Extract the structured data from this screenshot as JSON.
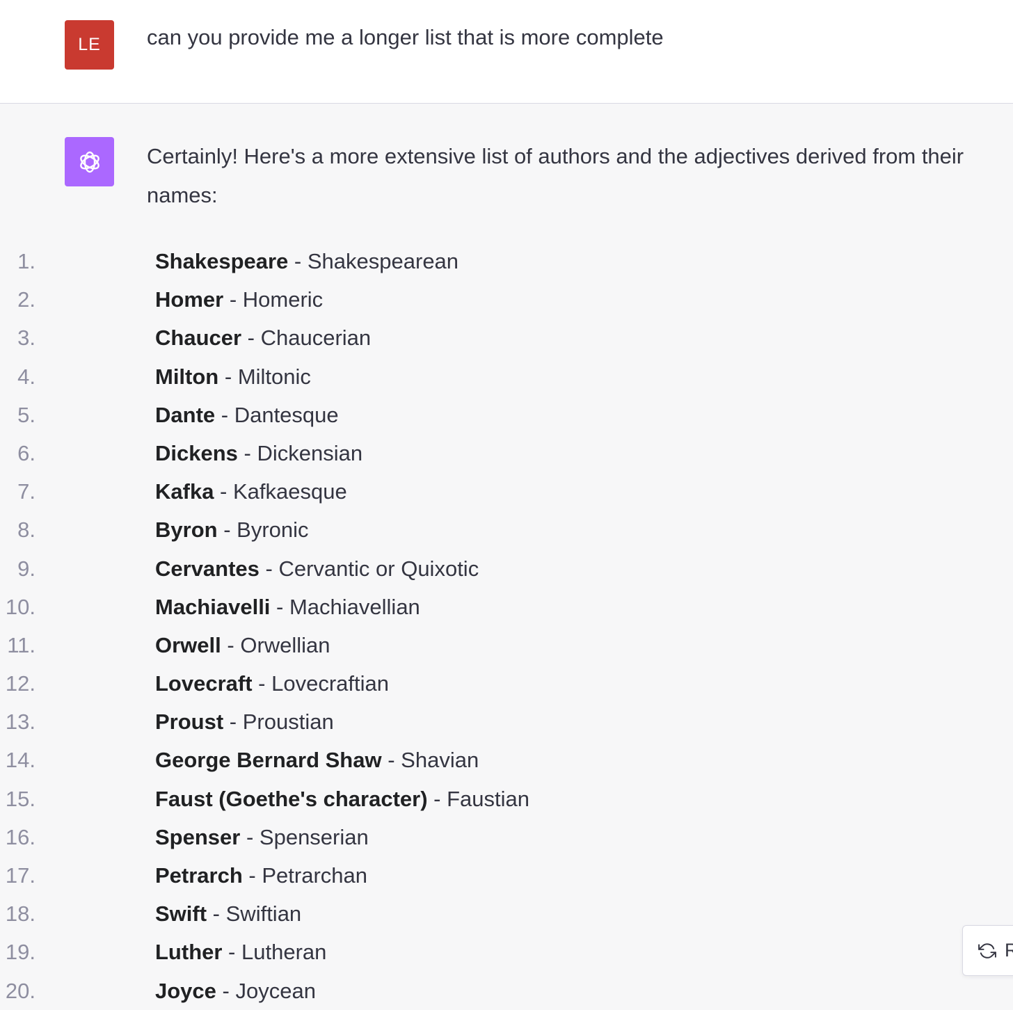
{
  "user_message": {
    "avatar_initials": "LE",
    "text": "can you provide me a longer list that is more complete"
  },
  "assistant_message": {
    "avatar_icon": "openai-logo-icon",
    "intro": "Certainly! Here's a more extensive list of authors and the adjectives derived from their names:",
    "items": [
      {
        "number": "1.",
        "author": "Shakespeare",
        "separator": " - ",
        "adjective": "Shakespearean"
      },
      {
        "number": "2.",
        "author": "Homer",
        "separator": " - ",
        "adjective": "Homeric"
      },
      {
        "number": "3.",
        "author": "Chaucer",
        "separator": " - ",
        "adjective": "Chaucerian"
      },
      {
        "number": "4.",
        "author": "Milton",
        "separator": " - ",
        "adjective": "Miltonic"
      },
      {
        "number": "5.",
        "author": "Dante",
        "separator": " - ",
        "adjective": "Dantesque"
      },
      {
        "number": "6.",
        "author": "Dickens",
        "separator": " - ",
        "adjective": "Dickensian"
      },
      {
        "number": "7.",
        "author": "Kafka",
        "separator": " - ",
        "adjective": "Kafkaesque"
      },
      {
        "number": "8.",
        "author": "Byron",
        "separator": " - ",
        "adjective": "Byronic"
      },
      {
        "number": "9.",
        "author": "Cervantes",
        "separator": " - ",
        "adjective": "Cervantic or Quixotic"
      },
      {
        "number": "10.",
        "author": "Machiavelli",
        "separator": " - ",
        "adjective": "Machiavellian"
      },
      {
        "number": "11.",
        "author": "Orwell",
        "separator": " - ",
        "adjective": "Orwellian"
      },
      {
        "number": "12.",
        "author": "Lovecraft",
        "separator": " - ",
        "adjective": "Lovecraftian"
      },
      {
        "number": "13.",
        "author": "Proust",
        "separator": " - ",
        "adjective": "Proustian"
      },
      {
        "number": "14.",
        "author": "George Bernard Shaw",
        "separator": " - ",
        "adjective": "Shavian"
      },
      {
        "number": "15.",
        "author": "Faust (Goethe's character)",
        "separator": " - ",
        "adjective": "Faustian"
      },
      {
        "number": "16.",
        "author": "Spenser",
        "separator": " - ",
        "adjective": "Spenserian"
      },
      {
        "number": "17.",
        "author": "Petrarch",
        "separator": " - ",
        "adjective": "Petrarchan"
      },
      {
        "number": "18.",
        "author": "Swift",
        "separator": " - ",
        "adjective": "Swiftian"
      },
      {
        "number": "19.",
        "author": "Luther",
        "separator": " - ",
        "adjective": "Lutheran"
      },
      {
        "number": "20.",
        "author": "Joyce",
        "separator": " - ",
        "adjective": "Joycean"
      }
    ]
  },
  "regenerate_button": {
    "icon": "refresh-icon",
    "label": "R"
  },
  "colors": {
    "user_avatar": "#c93a30",
    "assistant_avatar": "#ab68ff",
    "user_row_bg": "#ffffff",
    "assistant_row_bg": "#f7f7f8",
    "list_number": "#8e8ea0",
    "text": "#343541"
  }
}
